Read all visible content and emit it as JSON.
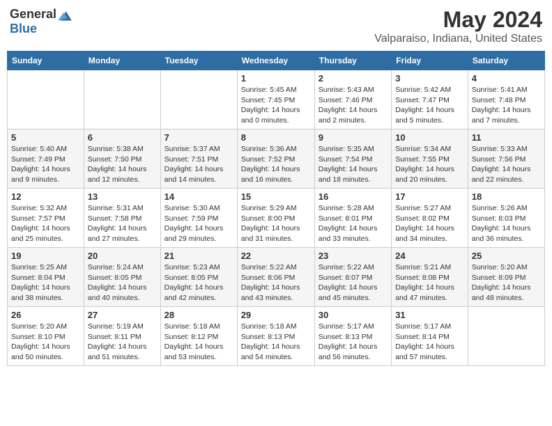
{
  "header": {
    "logo_general": "General",
    "logo_blue": "Blue",
    "title": "May 2024",
    "subtitle": "Valparaiso, Indiana, United States"
  },
  "days_of_week": [
    "Sunday",
    "Monday",
    "Tuesday",
    "Wednesday",
    "Thursday",
    "Friday",
    "Saturday"
  ],
  "weeks": [
    [
      {
        "day": "",
        "info": ""
      },
      {
        "day": "",
        "info": ""
      },
      {
        "day": "",
        "info": ""
      },
      {
        "day": "1",
        "info": "Sunrise: 5:45 AM\nSunset: 7:45 PM\nDaylight: 14 hours\nand 0 minutes."
      },
      {
        "day": "2",
        "info": "Sunrise: 5:43 AM\nSunset: 7:46 PM\nDaylight: 14 hours\nand 2 minutes."
      },
      {
        "day": "3",
        "info": "Sunrise: 5:42 AM\nSunset: 7:47 PM\nDaylight: 14 hours\nand 5 minutes."
      },
      {
        "day": "4",
        "info": "Sunrise: 5:41 AM\nSunset: 7:48 PM\nDaylight: 14 hours\nand 7 minutes."
      }
    ],
    [
      {
        "day": "5",
        "info": "Sunrise: 5:40 AM\nSunset: 7:49 PM\nDaylight: 14 hours\nand 9 minutes."
      },
      {
        "day": "6",
        "info": "Sunrise: 5:38 AM\nSunset: 7:50 PM\nDaylight: 14 hours\nand 12 minutes."
      },
      {
        "day": "7",
        "info": "Sunrise: 5:37 AM\nSunset: 7:51 PM\nDaylight: 14 hours\nand 14 minutes."
      },
      {
        "day": "8",
        "info": "Sunrise: 5:36 AM\nSunset: 7:52 PM\nDaylight: 14 hours\nand 16 minutes."
      },
      {
        "day": "9",
        "info": "Sunrise: 5:35 AM\nSunset: 7:54 PM\nDaylight: 14 hours\nand 18 minutes."
      },
      {
        "day": "10",
        "info": "Sunrise: 5:34 AM\nSunset: 7:55 PM\nDaylight: 14 hours\nand 20 minutes."
      },
      {
        "day": "11",
        "info": "Sunrise: 5:33 AM\nSunset: 7:56 PM\nDaylight: 14 hours\nand 22 minutes."
      }
    ],
    [
      {
        "day": "12",
        "info": "Sunrise: 5:32 AM\nSunset: 7:57 PM\nDaylight: 14 hours\nand 25 minutes."
      },
      {
        "day": "13",
        "info": "Sunrise: 5:31 AM\nSunset: 7:58 PM\nDaylight: 14 hours\nand 27 minutes."
      },
      {
        "day": "14",
        "info": "Sunrise: 5:30 AM\nSunset: 7:59 PM\nDaylight: 14 hours\nand 29 minutes."
      },
      {
        "day": "15",
        "info": "Sunrise: 5:29 AM\nSunset: 8:00 PM\nDaylight: 14 hours\nand 31 minutes."
      },
      {
        "day": "16",
        "info": "Sunrise: 5:28 AM\nSunset: 8:01 PM\nDaylight: 14 hours\nand 33 minutes."
      },
      {
        "day": "17",
        "info": "Sunrise: 5:27 AM\nSunset: 8:02 PM\nDaylight: 14 hours\nand 34 minutes."
      },
      {
        "day": "18",
        "info": "Sunrise: 5:26 AM\nSunset: 8:03 PM\nDaylight: 14 hours\nand 36 minutes."
      }
    ],
    [
      {
        "day": "19",
        "info": "Sunrise: 5:25 AM\nSunset: 8:04 PM\nDaylight: 14 hours\nand 38 minutes."
      },
      {
        "day": "20",
        "info": "Sunrise: 5:24 AM\nSunset: 8:05 PM\nDaylight: 14 hours\nand 40 minutes."
      },
      {
        "day": "21",
        "info": "Sunrise: 5:23 AM\nSunset: 8:05 PM\nDaylight: 14 hours\nand 42 minutes."
      },
      {
        "day": "22",
        "info": "Sunrise: 5:22 AM\nSunset: 8:06 PM\nDaylight: 14 hours\nand 43 minutes."
      },
      {
        "day": "23",
        "info": "Sunrise: 5:22 AM\nSunset: 8:07 PM\nDaylight: 14 hours\nand 45 minutes."
      },
      {
        "day": "24",
        "info": "Sunrise: 5:21 AM\nSunset: 8:08 PM\nDaylight: 14 hours\nand 47 minutes."
      },
      {
        "day": "25",
        "info": "Sunrise: 5:20 AM\nSunset: 8:09 PM\nDaylight: 14 hours\nand 48 minutes."
      }
    ],
    [
      {
        "day": "26",
        "info": "Sunrise: 5:20 AM\nSunset: 8:10 PM\nDaylight: 14 hours\nand 50 minutes."
      },
      {
        "day": "27",
        "info": "Sunrise: 5:19 AM\nSunset: 8:11 PM\nDaylight: 14 hours\nand 51 minutes."
      },
      {
        "day": "28",
        "info": "Sunrise: 5:18 AM\nSunset: 8:12 PM\nDaylight: 14 hours\nand 53 minutes."
      },
      {
        "day": "29",
        "info": "Sunrise: 5:18 AM\nSunset: 8:13 PM\nDaylight: 14 hours\nand 54 minutes."
      },
      {
        "day": "30",
        "info": "Sunrise: 5:17 AM\nSunset: 8:13 PM\nDaylight: 14 hours\nand 56 minutes."
      },
      {
        "day": "31",
        "info": "Sunrise: 5:17 AM\nSunset: 8:14 PM\nDaylight: 14 hours\nand 57 minutes."
      },
      {
        "day": "",
        "info": ""
      }
    ]
  ]
}
